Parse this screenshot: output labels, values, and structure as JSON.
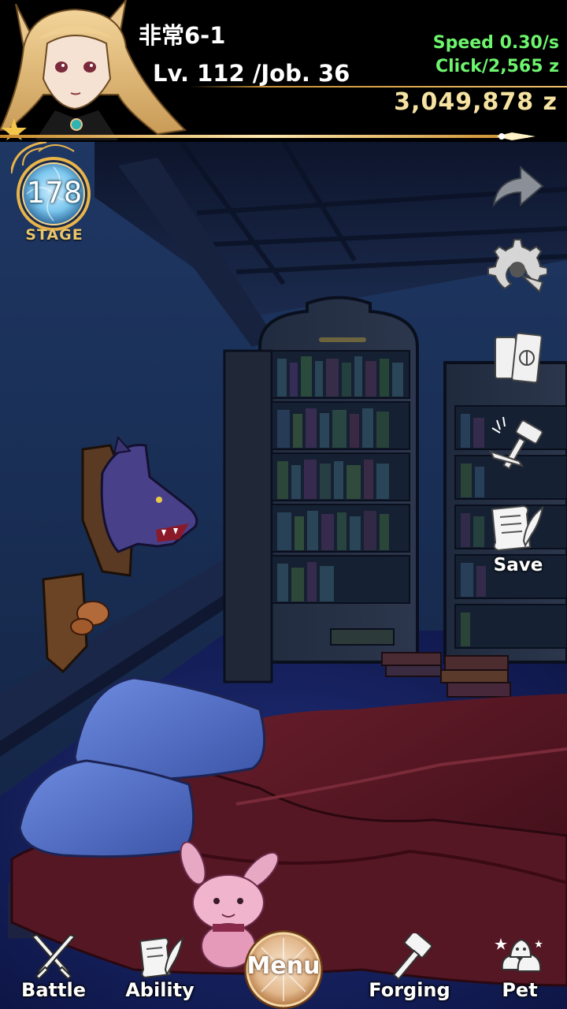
{
  "player": {
    "name": "非常6-1",
    "level_line": "Lv. 112 /Job. 36"
  },
  "economy": {
    "speed": "Speed 0.30/s",
    "click": "Click/2,565 z",
    "zeny": "3,049,878 z"
  },
  "stage": {
    "number": "178",
    "label": "STAGE"
  },
  "side_buttons": [
    {
      "icon": "share-arrow-icon"
    },
    {
      "icon": "settings-gear-icon"
    },
    {
      "icon": "books-icon"
    },
    {
      "icon": "forging-tools-icon"
    },
    {
      "icon": "save-scroll-icon",
      "label": "Save"
    }
  ],
  "nav": {
    "battle": "Battle",
    "ability": "Ability",
    "menu": "Menu",
    "forging": "Forging",
    "pet": "Pet"
  },
  "colors": {
    "stat_green": "#6df56d",
    "zeny_gold": "#f6e3a2",
    "accent_gold": "#e9b54a"
  }
}
